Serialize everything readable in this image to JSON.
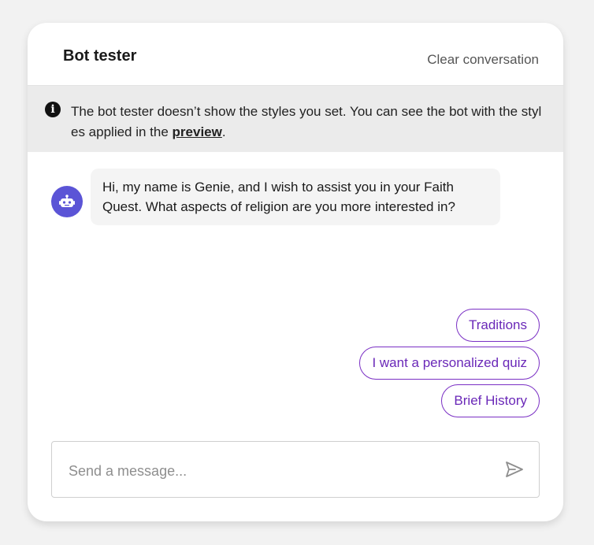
{
  "header": {
    "title": "Bot tester",
    "clear_label": "Clear conversation"
  },
  "notice": {
    "icon": "info-icon",
    "text_before": "The bot tester doesn’t show the styles you set. You can see the bot with the styles applied in the ",
    "link_label": "preview",
    "text_after": "."
  },
  "messages": [
    {
      "sender": "bot",
      "avatar_icon": "robot-icon",
      "text": "Hi, my name is Genie, and I wish to assist you in your Faith Quest. What aspects of religion are you more interested in?"
    }
  ],
  "quick_replies": [
    "Traditions",
    "I want a personalized quiz",
    "Brief History"
  ],
  "composer": {
    "placeholder": "Send a message...",
    "value": "",
    "send_icon": "send-icon"
  },
  "colors": {
    "accent": "#7a2fc4",
    "avatar_bg": "#5b54d6",
    "notice_bg": "#ebebeb"
  }
}
